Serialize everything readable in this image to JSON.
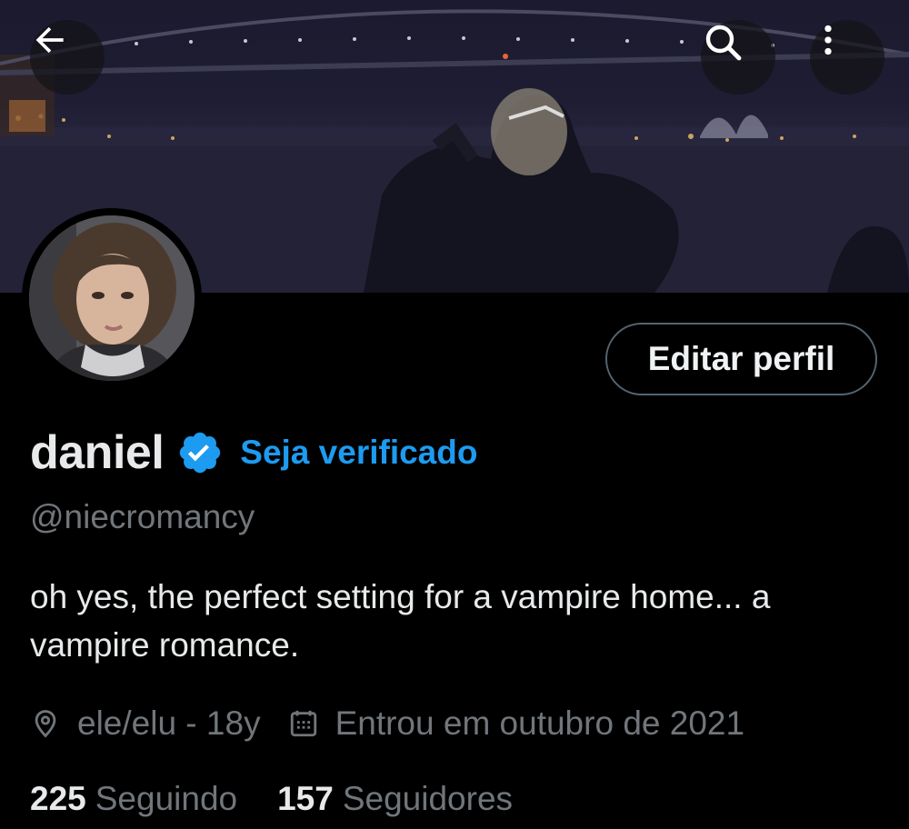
{
  "header": {
    "back_icon": "arrow-left-icon",
    "search_icon": "search-icon",
    "more_icon": "more-vertical-icon"
  },
  "profile": {
    "display_name": "daniel",
    "verified_icon": "verified-badge-icon",
    "get_verified_label": "Seja verificado",
    "handle": "@niecromancy",
    "bio": "oh yes, the perfect setting for a vampire home... a vampire romance.",
    "location_icon": "location-pin-icon",
    "location": "ele/elu - 18y",
    "joined_icon": "calendar-icon",
    "joined": "Entrou em outubro de 2021",
    "edit_profile_label": "Editar perfil"
  },
  "stats": {
    "following_count": "225",
    "following_label": "Seguindo",
    "followers_count": "157",
    "followers_label": "Seguidores"
  },
  "colors": {
    "accent": "#1d9bf0",
    "background": "#000000",
    "secondary_text": "#71767b",
    "primary_text": "#e7e9ea"
  }
}
